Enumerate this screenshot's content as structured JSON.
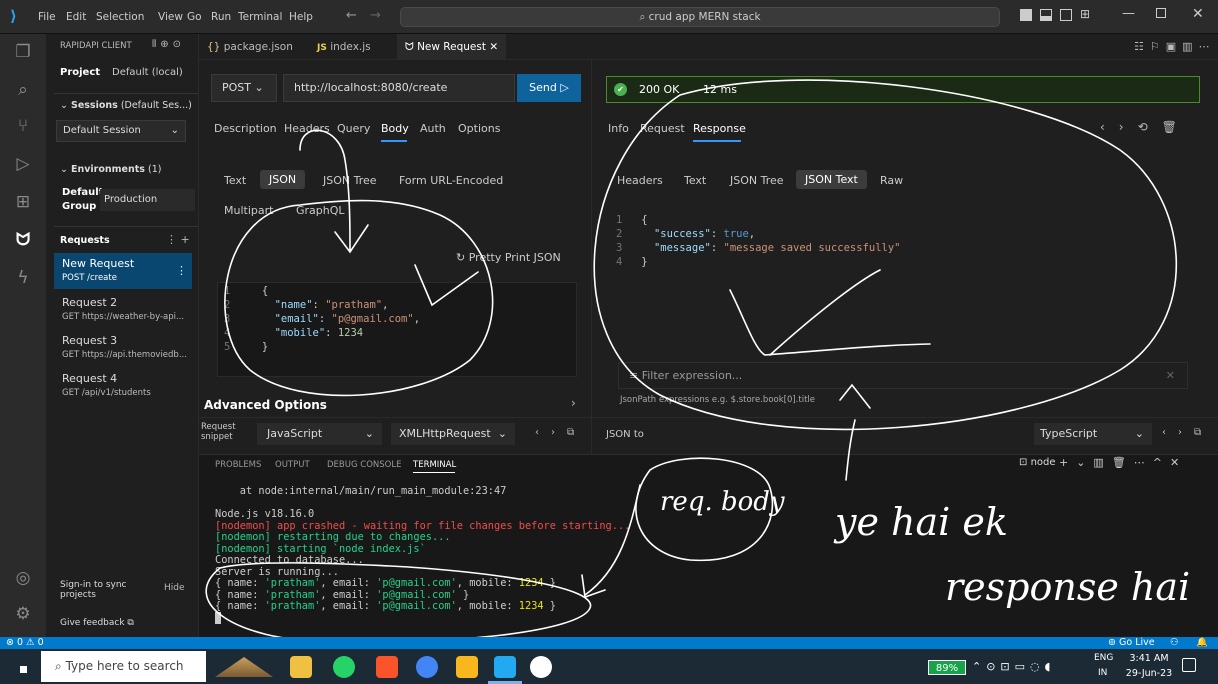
{
  "window": {
    "search": "crud app MERN stack",
    "menu": [
      "File",
      "Edit",
      "Selection",
      "View",
      "Go",
      "Run",
      "Terminal",
      "Help"
    ]
  },
  "sidebar": {
    "title": "RAPIDAPI CLIENT",
    "project_label": "Project",
    "project_value": "Default (local)",
    "sessions_label": "Sessions",
    "sessions_suffix": "(Default Ses...)",
    "session_select": "Default Session",
    "environments_label": "Environments",
    "environments_count": "(1)",
    "env_group": "Default Group",
    "env_value": "Production",
    "requests_label": "Requests",
    "requests": [
      {
        "name": "New Request",
        "sub": "POST /create"
      },
      {
        "name": "Request 2",
        "sub": "GET https://weather-by-api..."
      },
      {
        "name": "Request 3",
        "sub": "GET https://api.themoviedb..."
      },
      {
        "name": "Request 4",
        "sub": "GET /api/v1/students"
      }
    ],
    "signin": "Sign-in to sync projects",
    "hide": "Hide",
    "feedback": "Give feedback"
  },
  "tabs": [
    "package.json",
    "index.js",
    "New Request"
  ],
  "request": {
    "method": "POST",
    "url": "http://localhost:8080/create",
    "send": "Send",
    "tabs": [
      "Description",
      "Headers",
      "Query",
      "Body",
      "Auth",
      "Options"
    ],
    "active_tab": "Body",
    "body_types": [
      "Text",
      "JSON",
      "JSON Tree",
      "Form URL-Encoded",
      "Multipart",
      "GraphQL"
    ],
    "active_body": "JSON",
    "pretty": "Pretty Print JSON",
    "lines": [
      "1",
      "2",
      "3",
      "4",
      "5"
    ],
    "json": {
      "k1": "\"name\"",
      "v1": "\"pratham\"",
      "k2": "\"email\"",
      "v2": "\"p@gmail.com\"",
      "k3": "\"mobile\"",
      "v3": "1234"
    },
    "advanced": "Advanced Options",
    "snippet_label": "Request snippet",
    "lang": "JavaScript",
    "lib": "XMLHttpRequest"
  },
  "response": {
    "status": "200 OK",
    "time": "12 ms",
    "tabs": [
      "Info",
      "Request",
      "Response"
    ],
    "active_tab": "Response",
    "view_tabs": [
      "Headers",
      "Text",
      "JSON Tree",
      "JSON Text",
      "Raw"
    ],
    "active_view": "JSON Text",
    "lines": [
      "1",
      "2",
      "3",
      "4"
    ],
    "k1": "\"success\"",
    "v1": "true",
    "k2": "\"message\"",
    "v2": "\"message saved successfully\"",
    "filter_placeholder": "Filter expression...",
    "hint": "JsonPath expressions e.g. $.store.book[0].title",
    "json_to": "JSON to",
    "ts": "TypeScript"
  },
  "panel": {
    "tabs": [
      "PROBLEMS",
      "OUTPUT",
      "DEBUG CONSOLE",
      "TERMINAL"
    ],
    "active": "TERMINAL",
    "shell": "node",
    "t1": "    at node:internal/main/run_main_module:23:47",
    "t2": "Node.js v18.16.0",
    "t3": "[nodemon] app crashed - waiting for file changes before starting...",
    "t4": "[nodemon] restarting due to changes...",
    "t5": "[nodemon] starting `node index.js`",
    "t6": "Connected to database...",
    "t7": "Server is running...",
    "o_a": "{ name: ",
    "o_b": "'pratham'",
    "o_c": ", email: ",
    "o_d": "'p@gmail.com'",
    "o_e": ", mobile: ",
    "o_f": "1234",
    "o_g": " }",
    "o_h": " }"
  },
  "annotations": {
    "a1": "req. body",
    "a2": "ye hai ek",
    "a3": "response hai"
  },
  "status": {
    "left": "⊗ 0 ⚠ 0",
    "golive": "Go Live"
  },
  "taskbar": {
    "search": "Type here to search",
    "battery": "89%",
    "lang": "ENG",
    "region": "IN",
    "time": "3:41 AM",
    "date": "29-Jun-23"
  }
}
